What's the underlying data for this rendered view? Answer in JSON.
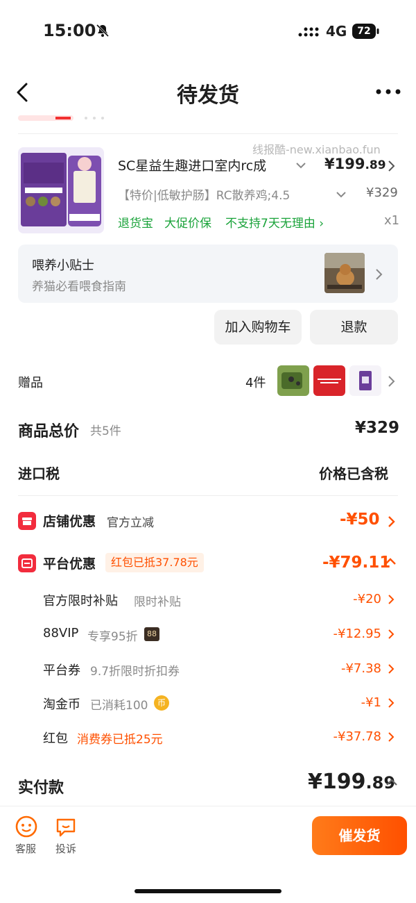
{
  "status_bar": {
    "time": "15:00",
    "network": "4G",
    "battery": "72"
  },
  "header": {
    "title": "待发货"
  },
  "watermark": "线报酷-new.xianbao.fun",
  "product": {
    "title": "SC星益生趣进口室内rc成",
    "price_int": "¥199",
    "price_dec": ".89",
    "spec": "【特价|低敏护肠】RC散养鸡;4.5",
    "original_price": "¥329",
    "tags": [
      "退货宝",
      "大促价保",
      "不支持7天无理由 ›"
    ],
    "quantity": "x1"
  },
  "tip": {
    "title": "喂养小贴士",
    "subtitle": "养猫必看喂食指南"
  },
  "actions": {
    "add_cart": "加入购物车",
    "refund": "退款"
  },
  "gifts": {
    "label": "赠品",
    "count": "4件"
  },
  "summary": {
    "total_label": "商品总价",
    "total_count": "共5件",
    "total_value": "¥329",
    "tax_label": "进口税",
    "tax_value": "价格已含税"
  },
  "shop_discount": {
    "label": "店铺优惠",
    "sub": "官方立减",
    "value": "-¥50"
  },
  "platform_discount": {
    "label": "平台优惠",
    "badge": "红包已抵37.78元",
    "value": "-¥79.11",
    "items": [
      {
        "label": "官方限时补贴",
        "note": "限时补贴",
        "value": "-¥20"
      },
      {
        "label": "88VIP",
        "note": "专享95折",
        "value": "-¥12.95"
      },
      {
        "label": "平台券",
        "note": "9.7折限时折扣券",
        "value": "-¥7.38"
      },
      {
        "label": "淘金币",
        "note": "已消耗100",
        "value": "-¥1"
      },
      {
        "label": "红包",
        "note": "消费券已抵25元",
        "value": "-¥37.78"
      }
    ],
    "vip_badge": "88",
    "coin_glyph": "币"
  },
  "paid": {
    "label": "实付款",
    "value_int": "¥199",
    "value_dec": ".89"
  },
  "bottom": {
    "service": "客服",
    "complain": "投诉",
    "urge": "催发货"
  },
  "colors": {
    "accent": "#ff5000",
    "green": "#1aa33a",
    "discount_icon": "#f22c3d"
  }
}
